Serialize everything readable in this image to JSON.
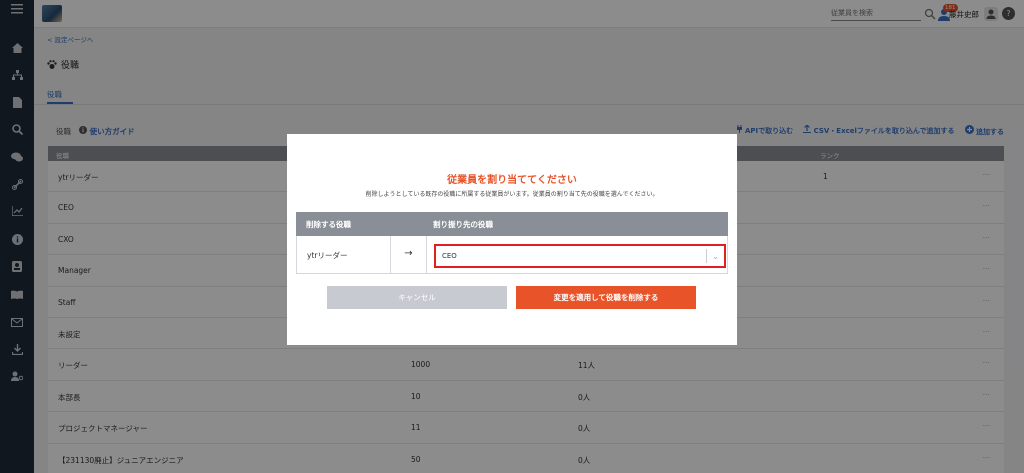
{
  "topbar": {
    "search_placeholder": "従業員を検索",
    "notification_count": "181",
    "user_name": "藤井史郎",
    "help": "?"
  },
  "sidebar": {
    "icons": [
      "menu-icon",
      "home-icon",
      "org-chart-icon",
      "document-icon",
      "search-icon",
      "chat-icon",
      "link-icon",
      "analytics-icon",
      "info-icon",
      "profile-card-icon",
      "book-icon",
      "mail-icon",
      "download-icon",
      "user-settings-icon"
    ]
  },
  "page": {
    "back_link": "< 設定ページへ",
    "title": "役職",
    "tab": "役職",
    "toolbar_label": "役職",
    "guide": "使い方ガイド",
    "actions": {
      "api": "APIで取り込む",
      "csv": "CSV・Excelファイルを取り込んで追加する",
      "add": "追加する"
    }
  },
  "table": {
    "headers": [
      "役職",
      "ランク"
    ],
    "rows": [
      {
        "name": "ytrリーダー",
        "col2": "",
        "col3": "",
        "rank": "1"
      },
      {
        "name": "CEO",
        "col2": "",
        "col3": "",
        "rank": ""
      },
      {
        "name": "CXO",
        "col2": "",
        "col3": "",
        "rank": ""
      },
      {
        "name": "Manager",
        "col2": "",
        "col3": "",
        "rank": ""
      },
      {
        "name": "Staff",
        "col2": "",
        "col3": "",
        "rank": ""
      },
      {
        "name": "未設定",
        "col2": "",
        "col3": "",
        "rank": ""
      },
      {
        "name": "リーダー",
        "col2": "1000",
        "col3": "11人",
        "rank": ""
      },
      {
        "name": "本部長",
        "col2": "10",
        "col3": "0人",
        "rank": ""
      },
      {
        "name": "プロジェクトマネージャー",
        "col2": "11",
        "col3": "0人",
        "rank": ""
      },
      {
        "name": "【231130廃止】ジュニアエンジニア",
        "col2": "50",
        "col3": "0人",
        "rank": ""
      }
    ]
  },
  "modal": {
    "title": "従業員を割り当ててください",
    "subtitle": "削除しようとしている既存の役職に所属する従業員がいます。従業員の割り当て先の役職を選んでください。",
    "col_from": "削除する役職",
    "col_to": "割り振り先の役職",
    "from_value": "ytrリーダー",
    "arrow": "→",
    "selected": "CEO",
    "cancel": "キャンセル",
    "apply": "変更を適用して役職を削除する"
  },
  "colors": {
    "accent": "#e8532a",
    "link": "#3a6fc4",
    "sidebar": "#1f2a37",
    "highlight": "#e02020"
  }
}
